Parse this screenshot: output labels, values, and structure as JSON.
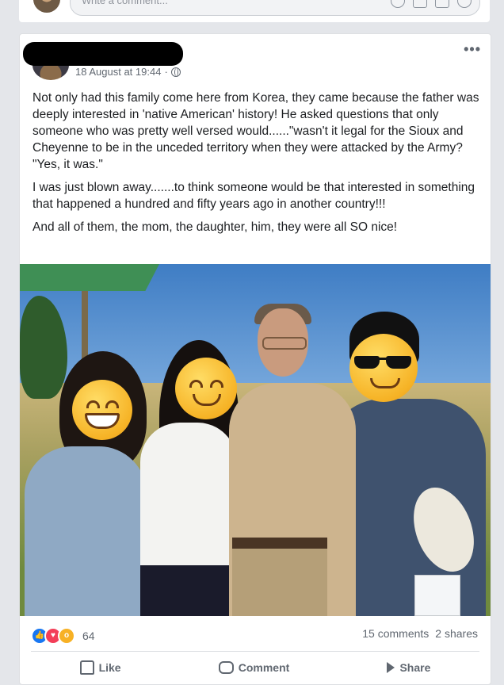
{
  "previous_post": {
    "comment_placeholder": "Write a comment...",
    "comment_icons": [
      "emoji-icon",
      "camera-icon",
      "gif-icon",
      "sticker-icon"
    ]
  },
  "post": {
    "author_name_redacted": true,
    "timestamp": "18 August at 19:44",
    "separator": "·",
    "privacy_icon": "globe-icon",
    "more_options": "•••",
    "paragraphs": [
      "Not only had this family come here from Korea, they came because the father was deeply interested in 'native American' history! He asked questions that only someone who was pretty well versed would......\"wasn't it legal for the Sioux and Cheyenne to be in the unceded territory when they were attacked by the Army? \"Yes, it was.\"",
      "I was just blown away.......to think someone would be that interested in something that happened a hundred and fifty years ago in another country!!!",
      "And all of them, the mom, the daughter, him, they were all SO nice!"
    ]
  },
  "engagement": {
    "reaction_icons": [
      "like-react-icon",
      "love-react-icon",
      "wow-react-icon"
    ],
    "reaction_count": "64",
    "comments": "15 comments",
    "shares": "2 shares"
  },
  "actions": {
    "like": "Like",
    "comment": "Comment",
    "share": "Share"
  },
  "colors": {
    "facebook_blue": "#1877f2",
    "love_red": "#f33e58",
    "wow_yellow": "#f7b125",
    "meta_gray": "#606770"
  }
}
